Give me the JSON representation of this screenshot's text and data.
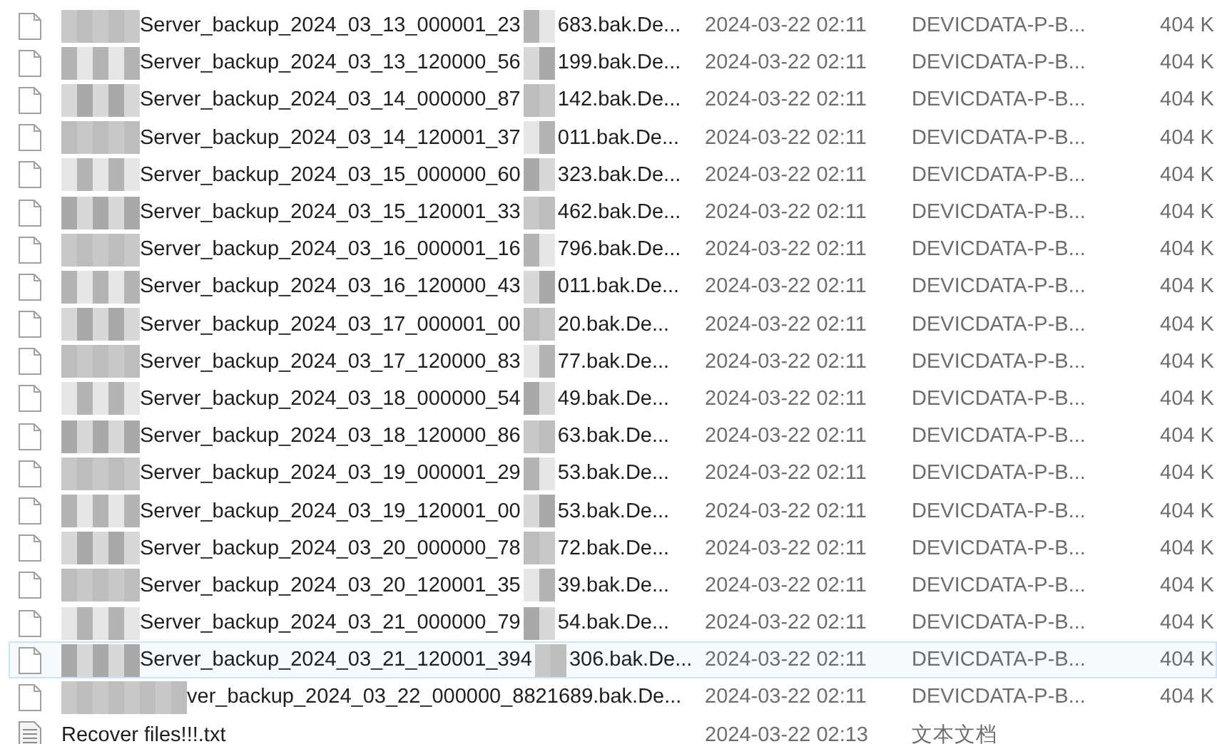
{
  "files": [
    {
      "kind": "backup",
      "name_start": "Server_backup_2024_03_13_000001_23",
      "name_end": "683.bak.De...",
      "modified": "2024-03-22 02:11",
      "type": "DEVICDATA-P-B...",
      "size": "404 K",
      "selected": false
    },
    {
      "kind": "backup",
      "name_start": "Server_backup_2024_03_13_120000_56",
      "name_end": "199.bak.De...",
      "modified": "2024-03-22 02:11",
      "type": "DEVICDATA-P-B...",
      "size": "404 K",
      "selected": false
    },
    {
      "kind": "backup",
      "name_start": "Server_backup_2024_03_14_000000_87",
      "name_end": "142.bak.De...",
      "modified": "2024-03-22 02:11",
      "type": "DEVICDATA-P-B...",
      "size": "404 K",
      "selected": false
    },
    {
      "kind": "backup",
      "name_start": "Server_backup_2024_03_14_120001_37",
      "name_end": "011.bak.De...",
      "modified": "2024-03-22 02:11",
      "type": "DEVICDATA-P-B...",
      "size": "404 K",
      "selected": false
    },
    {
      "kind": "backup",
      "name_start": "Server_backup_2024_03_15_000000_60",
      "name_end": "323.bak.De...",
      "modified": "2024-03-22 02:11",
      "type": "DEVICDATA-P-B...",
      "size": "404 K",
      "selected": false
    },
    {
      "kind": "backup",
      "name_start": "Server_backup_2024_03_15_120001_33",
      "name_end": "462.bak.De...",
      "modified": "2024-03-22 02:11",
      "type": "DEVICDATA-P-B...",
      "size": "404 K",
      "selected": false
    },
    {
      "kind": "backup",
      "name_start": "Server_backup_2024_03_16_000001_16",
      "name_end": "796.bak.De...",
      "modified": "2024-03-22 02:11",
      "type": "DEVICDATA-P-B...",
      "size": "404 K",
      "selected": false
    },
    {
      "kind": "backup",
      "name_start": "Server_backup_2024_03_16_120000_43",
      "name_end": "011.bak.De...",
      "modified": "2024-03-22 02:11",
      "type": "DEVICDATA-P-B...",
      "size": "404 K",
      "selected": false
    },
    {
      "kind": "backup",
      "name_start": "Server_backup_2024_03_17_000001_00",
      "name_end": "20.bak.De...",
      "modified": "2024-03-22 02:11",
      "type": "DEVICDATA-P-B...",
      "size": "404 K",
      "selected": false
    },
    {
      "kind": "backup",
      "name_start": "Server_backup_2024_03_17_120000_83",
      "name_end": "77.bak.De...",
      "modified": "2024-03-22 02:11",
      "type": "DEVICDATA-P-B...",
      "size": "404 K",
      "selected": false
    },
    {
      "kind": "backup",
      "name_start": "Server_backup_2024_03_18_000000_54",
      "name_end": "49.bak.De...",
      "modified": "2024-03-22 02:11",
      "type": "DEVICDATA-P-B...",
      "size": "404 K",
      "selected": false
    },
    {
      "kind": "backup",
      "name_start": "Server_backup_2024_03_18_120000_86",
      "name_end": "63.bak.De...",
      "modified": "2024-03-22 02:11",
      "type": "DEVICDATA-P-B...",
      "size": "404 K",
      "selected": false
    },
    {
      "kind": "backup",
      "name_start": "Server_backup_2024_03_19_000001_29",
      "name_end": "53.bak.De...",
      "modified": "2024-03-22 02:11",
      "type": "DEVICDATA-P-B...",
      "size": "404 K",
      "selected": false
    },
    {
      "kind": "backup",
      "name_start": "Server_backup_2024_03_19_120001_00",
      "name_end": "53.bak.De...",
      "modified": "2024-03-22 02:11",
      "type": "DEVICDATA-P-B...",
      "size": "404 K",
      "selected": false
    },
    {
      "kind": "backup",
      "name_start": "Server_backup_2024_03_20_000000_78",
      "name_end": "72.bak.De...",
      "modified": "2024-03-22 02:11",
      "type": "DEVICDATA-P-B...",
      "size": "404 K",
      "selected": false
    },
    {
      "kind": "backup",
      "name_start": "Server_backup_2024_03_20_120001_35",
      "name_end": "39.bak.De...",
      "modified": "2024-03-22 02:11",
      "type": "DEVICDATA-P-B...",
      "size": "404 K",
      "selected": false
    },
    {
      "kind": "backup",
      "name_start": "Server_backup_2024_03_21_000000_79",
      "name_end": "54.bak.De...",
      "modified": "2024-03-22 02:11",
      "type": "DEVICDATA-P-B...",
      "size": "404 K",
      "selected": false
    },
    {
      "kind": "backup",
      "name_start": "Server_backup_2024_03_21_120001_394",
      "name_end": "306.bak.De...",
      "modified": "2024-03-22 02:11",
      "type": "DEVICDATA-P-B...",
      "size": "404 K",
      "selected": true
    },
    {
      "kind": "backup_tail",
      "name_start": "ver_backup_2024_03_22_000000_8821689.bak.De...",
      "modified": "2024-03-22 02:11",
      "type": "DEVICDATA-P-B...",
      "size": "404 K",
      "selected": false
    },
    {
      "kind": "text",
      "name_start": "Recover files!!!.txt",
      "modified": "2024-03-22 02:13",
      "type": "文本文档",
      "selected": false
    }
  ]
}
